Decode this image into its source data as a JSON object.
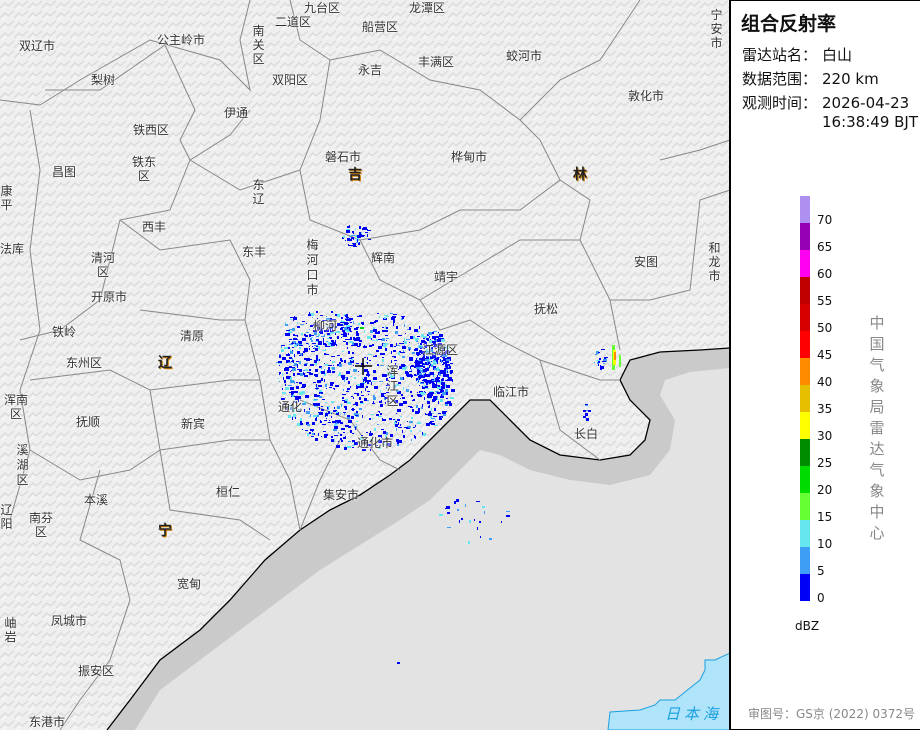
{
  "panel": {
    "title": "组合反射率",
    "station_label": "雷达站名：",
    "station_value": "白山",
    "range_label": "数据范围：",
    "range_value": "220 km",
    "time_label": "观测时间：",
    "time_date": "2026-04-23",
    "time_clock": "16:38:49 BJT",
    "unit": "dBZ",
    "agency": "中国气象局雷达气象中心",
    "approval": "审图号：GS京 (2022) 0372号"
  },
  "legend": {
    "ticks": [
      "70",
      "65",
      "60",
      "55",
      "50",
      "45",
      "40",
      "35",
      "30",
      "25",
      "20",
      "15",
      "10",
      "5",
      "0"
    ],
    "colors": [
      "#ad90f0",
      "#9600b4",
      "#ff00f0",
      "#c00000",
      "#d60000",
      "#ff0000",
      "#ff8c00",
      "#e6bf00",
      "#ffff00",
      "#008c00",
      "#00dc00",
      "#66ff33",
      "#66e6ee",
      "#3e9ef6",
      "#0000f6"
    ]
  },
  "map": {
    "provinces": [
      "吉",
      "林",
      "辽",
      "宁"
    ],
    "sea": "日本海",
    "places": [
      "双辽市",
      "公主岭市",
      "九台区",
      "二道区",
      "南关区",
      "双阳区",
      "梨树",
      "伊通",
      "铁西区",
      "铁东区",
      "昌图",
      "康平",
      "磐石市",
      "东辽",
      "西丰",
      "船营区",
      "龙潭区",
      "永吉",
      "丰满区",
      "蛟河市",
      "宁安市",
      "敦化市",
      "桦甸市",
      "法库",
      "清河区",
      "开原市",
      "东丰",
      "梅河口市",
      "辉南",
      "靖宇",
      "安图",
      "和龙市",
      "铁岭",
      "清原",
      "东州区",
      "抚松",
      "柳河",
      "浑南区",
      "抚顺",
      "新宾",
      "通化",
      "江源区",
      "浑江区",
      "临江市",
      "通化市",
      "长白",
      "溪湖区",
      "本溪",
      "桓仁",
      "集安市",
      "辽阳",
      "南芬区",
      "宽甸",
      "岫岩",
      "凤城市",
      "振安区",
      "东港市"
    ]
  }
}
